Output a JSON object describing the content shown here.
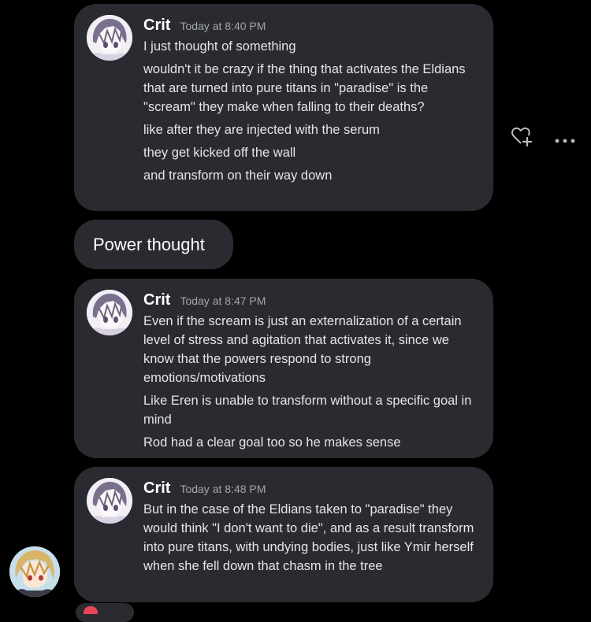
{
  "messages": [
    {
      "author": "Crit",
      "timestamp": "Today at 8:40 PM",
      "lines": [
        "I just thought of something",
        "wouldn't it be crazy if the thing that activates the Eldians that are turned into pure titans in \"paradise\" is the \"scream\" they make when falling to their deaths?",
        "like after they are injected with the serum",
        "they get kicked off the wall",
        "and transform on their way down"
      ]
    },
    {
      "author": "Crit",
      "timestamp": "Today at 8:47 PM",
      "lines": [
        "Even if the scream is just an externalization of a certain level of stress and agitation that activates it, since we know that the powers respond to strong emotions/motivations",
        "Like Eren is unable to transform without a specific goal in mind",
        "Rod had a clear goal too so he makes sense"
      ]
    },
    {
      "author": "Crit",
      "timestamp": "Today at 8:48 PM",
      "lines": [
        "But in the case of the Eldians taken to \"paradise\" they would think \"I don't want to die\", and as a result transform into pure titans, with undying bodies, just like Ymir herself when she fell down that chasm in the tree"
      ]
    }
  ],
  "reply": {
    "text": "Power thought"
  },
  "actions": {
    "add_reaction_icon": "heart-plus-icon",
    "more_icon": "more-horizontal-icon"
  },
  "colors": {
    "background": "#000000",
    "bubble": "#2a2b30",
    "author": "#ffffff",
    "timestamp": "#a3a6aa",
    "body_text": "#e3e5e8"
  }
}
